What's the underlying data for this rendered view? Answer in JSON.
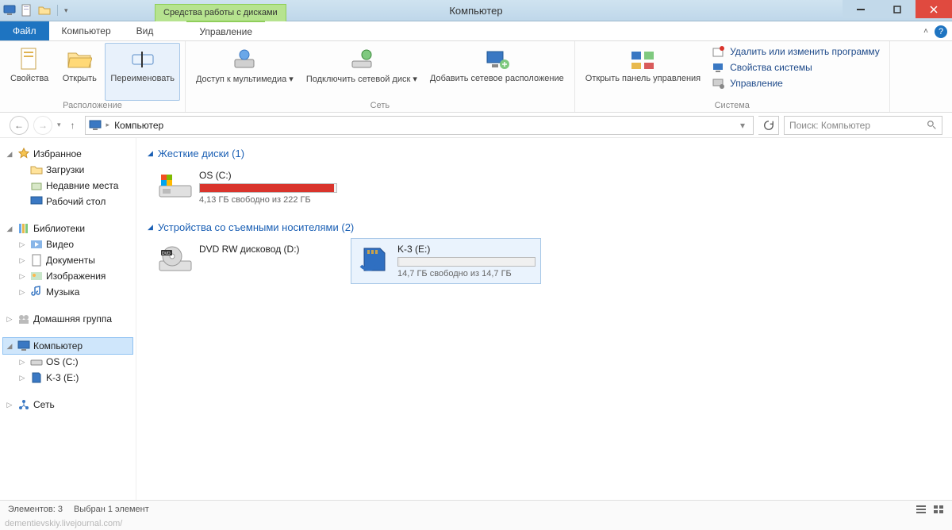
{
  "window": {
    "title": "Компьютер",
    "context_tab": "Средства работы с дисками"
  },
  "tabs": {
    "file": "Файл",
    "computer": "Компьютер",
    "view": "Вид",
    "manage": "Управление"
  },
  "ribbon": {
    "group_location": "Расположение",
    "group_network": "Сеть",
    "group_system": "Система",
    "properties": "Свойства",
    "open": "Открыть",
    "rename": "Переименовать",
    "media_access": "Доступ к мультимедиа ▾",
    "map_drive": "Подключить сетевой диск ▾",
    "add_netloc": "Добавить сетевое расположение",
    "open_cpl": "Открыть панель управления",
    "uninstall": "Удалить или изменить программу",
    "sys_props": "Свойства системы",
    "manage": "Управление"
  },
  "nav": {
    "breadcrumb": "Компьютер",
    "search_placeholder": "Поиск: Компьютер"
  },
  "tree": {
    "favorites": "Избранное",
    "downloads": "Загрузки",
    "recent": "Недавние места",
    "desktop": "Рабочий стол",
    "libraries": "Библиотеки",
    "videos": "Видео",
    "documents": "Документы",
    "pictures": "Изображения",
    "music": "Музыка",
    "homegroup": "Домашняя группа",
    "computer": "Компьютер",
    "os_c": "OS (C:)",
    "k3_e": "K-3 (E:)",
    "network": "Сеть"
  },
  "content": {
    "hdd_header": "Жесткие диски (1)",
    "removable_header": "Устройства со съемными носителями (2)",
    "os": {
      "name": "OS (C:)",
      "free_text": "4,13 ГБ свободно из 222 ГБ"
    },
    "dvd": {
      "name": "DVD RW дисковод (D:)"
    },
    "sd": {
      "name": "K-3 (E:)",
      "free_text": "14,7 ГБ свободно из 14,7 ГБ"
    }
  },
  "status": {
    "elements": "Элементов: 3",
    "selected": "Выбран 1 элемент"
  },
  "watermark": "dementievskiy.livejournal.com/"
}
